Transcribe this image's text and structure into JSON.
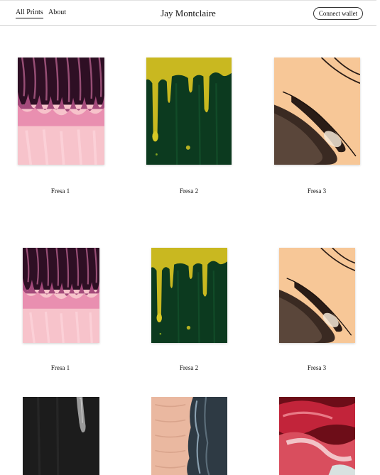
{
  "header": {
    "nav": [
      {
        "label": "All Prints",
        "active": true
      },
      {
        "label": "About",
        "active": false
      }
    ],
    "site_title": "Jay Montclaire",
    "wallet_button": "Connect wallet"
  },
  "prints": [
    {
      "title": "Fresa 1",
      "art": "pink-drip"
    },
    {
      "title": "Fresa 2",
      "art": "green-drip"
    },
    {
      "title": "Fresa 3",
      "art": "peach-swirl"
    },
    {
      "title": "Fresa 1",
      "art": "pink-drip"
    },
    {
      "title": "Fresa 2",
      "art": "green-drip"
    },
    {
      "title": "Fresa 3",
      "art": "peach-swirl"
    },
    {
      "title": "",
      "art": "black-drip"
    },
    {
      "title": "",
      "art": "salmon-texture"
    },
    {
      "title": "",
      "art": "red-swirl"
    }
  ]
}
